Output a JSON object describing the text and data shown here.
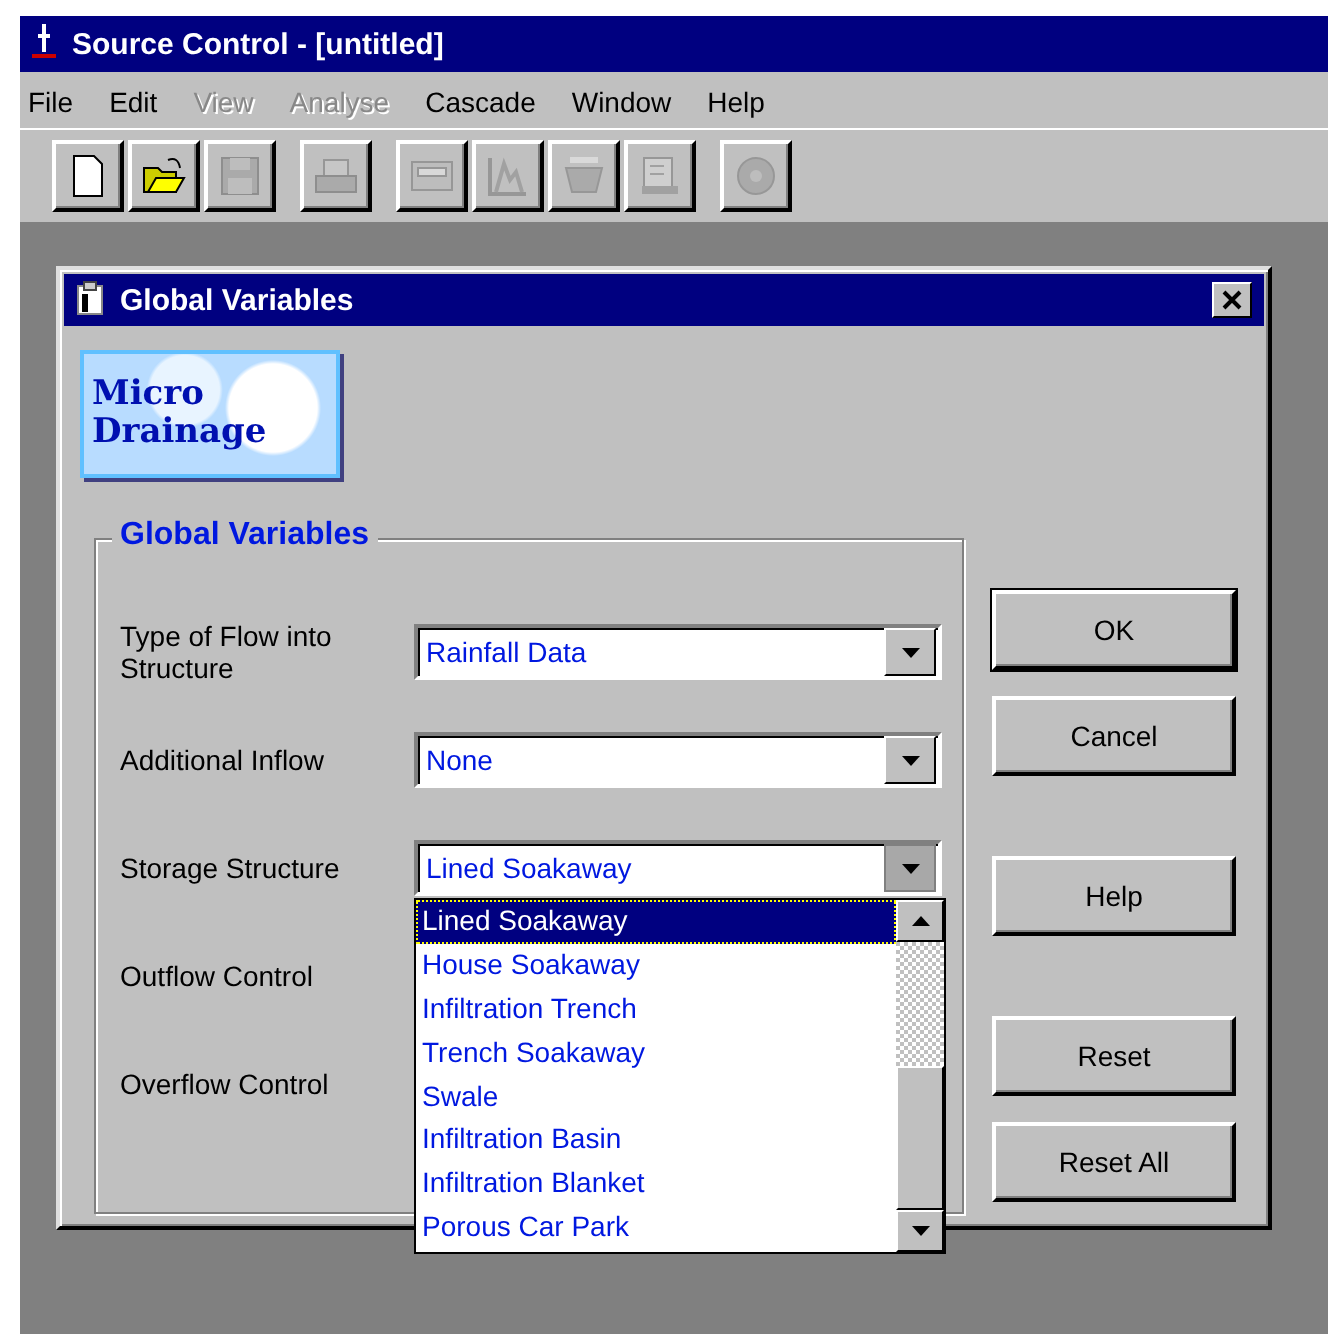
{
  "window": {
    "title": "Source Control - [untitled]"
  },
  "menu": [
    {
      "label": "File",
      "disabled": false
    },
    {
      "label": "Edit",
      "disabled": false
    },
    {
      "label": "View",
      "disabled": true
    },
    {
      "label": "Analyse",
      "disabled": true
    },
    {
      "label": "Cascade",
      "disabled": false
    },
    {
      "label": "Window",
      "disabled": false
    },
    {
      "label": "Help",
      "disabled": false
    }
  ],
  "toolbar": [
    [
      {
        "kind": "new",
        "disabled": false
      },
      {
        "kind": "open",
        "disabled": false
      },
      {
        "kind": "save",
        "disabled": true
      }
    ],
    [
      {
        "kind": "print",
        "disabled": true
      }
    ],
    [
      {
        "kind": "panel",
        "disabled": true
      },
      {
        "kind": "graph",
        "disabled": true
      },
      {
        "kind": "basket",
        "disabled": true
      },
      {
        "kind": "report",
        "disabled": true
      }
    ],
    [
      {
        "kind": "disc",
        "disabled": true
      }
    ]
  ],
  "dialog": {
    "title": "Global Variables",
    "logo": [
      "Micro",
      "Drainage"
    ],
    "group_title": "Global Variables",
    "fields": [
      {
        "kind": "combo",
        "label": "Type of Flow into Structure",
        "value": "Rainfall Data"
      },
      {
        "kind": "combo",
        "label": "Additional Inflow",
        "value": "None"
      },
      {
        "kind": "combo",
        "label": "Storage Structure",
        "value": "Lined Soakaway",
        "expanded": true
      },
      {
        "kind": "label",
        "label": "Outflow Control"
      },
      {
        "kind": "label",
        "label": "Overflow Control"
      }
    ],
    "dropdown_list": [
      {
        "label": "Lined Soakaway",
        "selected": true
      },
      {
        "label": "House Soakaway",
        "selected": false
      },
      {
        "label": "Infiltration Trench",
        "selected": false
      },
      {
        "label": "Trench Soakaway",
        "selected": false
      },
      {
        "label": "Swale",
        "selected": false
      },
      {
        "label": "Infiltration Basin",
        "selected": false
      },
      {
        "label": "Infiltration Blanket",
        "selected": false
      },
      {
        "label": "Porous Car Park",
        "selected": false
      }
    ],
    "buttons": [
      {
        "label": "OK",
        "default": true
      },
      {
        "label": "Cancel",
        "default": false
      },
      {
        "label": "Help",
        "default": false
      },
      {
        "label": "Reset",
        "default": false
      },
      {
        "label": "Reset All",
        "default": false
      }
    ]
  }
}
